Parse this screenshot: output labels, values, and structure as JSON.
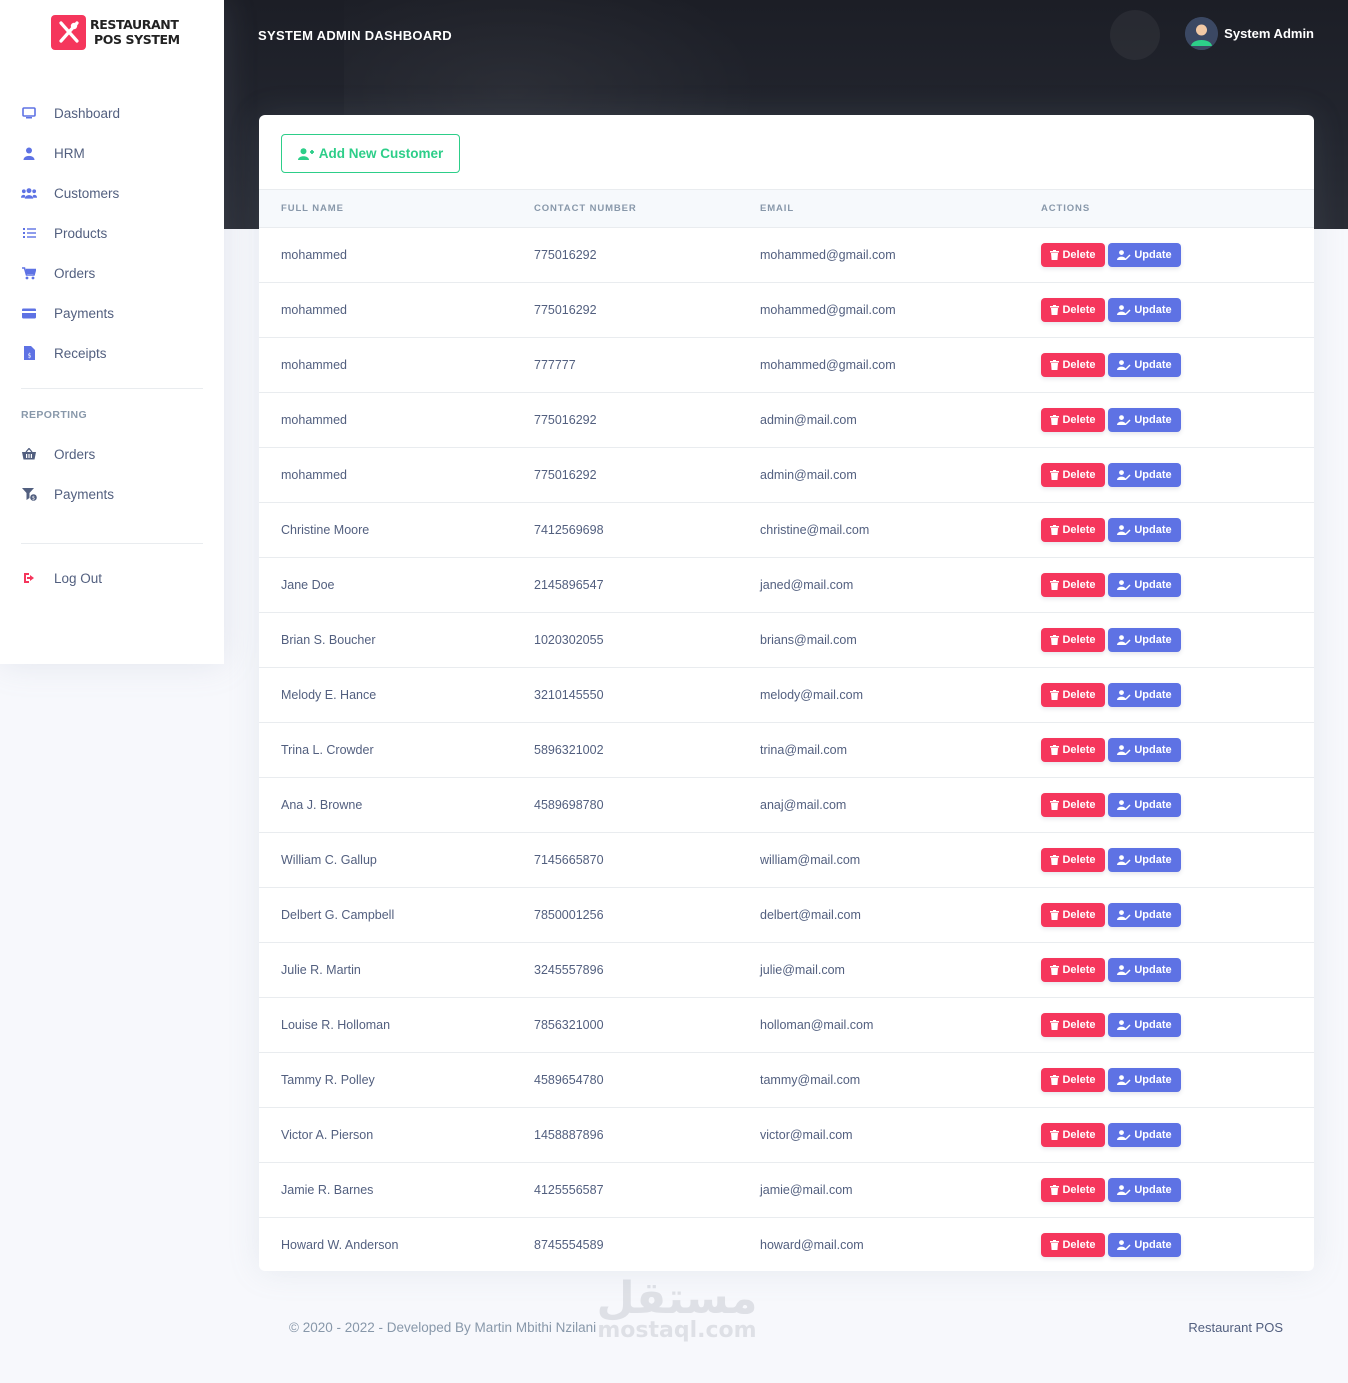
{
  "app": {
    "logo_line1": "RESTAURANT",
    "logo_line2": "POS SYSTEM",
    "dashboard_title": "SYSTEM ADMIN DASHBOARD",
    "user_name": "System Admin"
  },
  "sidebar": {
    "main_items": [
      {
        "label": "Dashboard",
        "icon": "monitor-icon",
        "color": "#5e72e4"
      },
      {
        "label": "HRM",
        "icon": "user-icon",
        "color": "#5e72e4"
      },
      {
        "label": "Customers",
        "icon": "users-icon",
        "color": "#5e72e4"
      },
      {
        "label": "Products",
        "icon": "list-icon",
        "color": "#5e72e4"
      },
      {
        "label": "Orders",
        "icon": "cart-icon",
        "color": "#5e72e4"
      },
      {
        "label": "Payments",
        "icon": "credit-card-icon",
        "color": "#5e72e4"
      },
      {
        "label": "Receipts",
        "icon": "invoice-icon",
        "color": "#5e72e4"
      }
    ],
    "reporting_heading": "REPORTING",
    "reporting_items": [
      {
        "label": "Orders",
        "icon": "basket-icon",
        "color": "#525f7f"
      },
      {
        "label": "Payments",
        "icon": "funnel-dollar-icon",
        "color": "#525f7f"
      }
    ],
    "logout_label": "Log Out",
    "logout_color": "#f5365c"
  },
  "toolbar": {
    "add_label": "Add New Customer"
  },
  "table": {
    "headers": [
      "FULL NAME",
      "CONTACT NUMBER",
      "EMAIL",
      "ACTIONS"
    ],
    "delete_label": "Delete",
    "update_label": "Update",
    "rows": [
      {
        "name": "mohammed",
        "phone": "775016292",
        "email": "mohammed@gmail.com"
      },
      {
        "name": "mohammed",
        "phone": "775016292",
        "email": "mohammed@gmail.com"
      },
      {
        "name": "mohammed",
        "phone": "777777",
        "email": "mohammed@gmail.com"
      },
      {
        "name": "mohammed",
        "phone": "775016292",
        "email": "admin@mail.com"
      },
      {
        "name": "mohammed",
        "phone": "775016292",
        "email": "admin@mail.com"
      },
      {
        "name": "Christine Moore",
        "phone": "7412569698",
        "email": "christine@mail.com"
      },
      {
        "name": "Jane Doe",
        "phone": "2145896547",
        "email": "janed@mail.com"
      },
      {
        "name": "Brian S. Boucher",
        "phone": "1020302055",
        "email": "brians@mail.com"
      },
      {
        "name": "Melody E. Hance",
        "phone": "3210145550",
        "email": "melody@mail.com"
      },
      {
        "name": "Trina L. Crowder",
        "phone": "5896321002",
        "email": "trina@mail.com"
      },
      {
        "name": "Ana J. Browne",
        "phone": "4589698780",
        "email": "anaj@mail.com"
      },
      {
        "name": "William C. Gallup",
        "phone": "7145665870",
        "email": "william@mail.com"
      },
      {
        "name": "Delbert G. Campbell",
        "phone": "7850001256",
        "email": "delbert@mail.com"
      },
      {
        "name": "Julie R. Martin",
        "phone": "3245557896",
        "email": "julie@mail.com"
      },
      {
        "name": "Louise R. Holloman",
        "phone": "7856321000",
        "email": "holloman@mail.com"
      },
      {
        "name": "Tammy R. Polley",
        "phone": "4589654780",
        "email": "tammy@mail.com"
      },
      {
        "name": "Victor A. Pierson",
        "phone": "1458887896",
        "email": "victor@mail.com"
      },
      {
        "name": "Jamie R. Barnes",
        "phone": "4125556587",
        "email": "jamie@mail.com"
      },
      {
        "name": "Howard W. Anderson",
        "phone": "8745554589",
        "email": "howard@mail.com"
      }
    ]
  },
  "footer": {
    "copyright": "© 2020 - 2022 - Developed By Martin Mbithi Nzilani",
    "brand": "Restaurant POS"
  },
  "watermark": {
    "arabic": "مستقل",
    "latin": "mostaql.com"
  },
  "colors": {
    "primary": "#5e72e4",
    "danger": "#f5365c",
    "success": "#2dce89"
  }
}
